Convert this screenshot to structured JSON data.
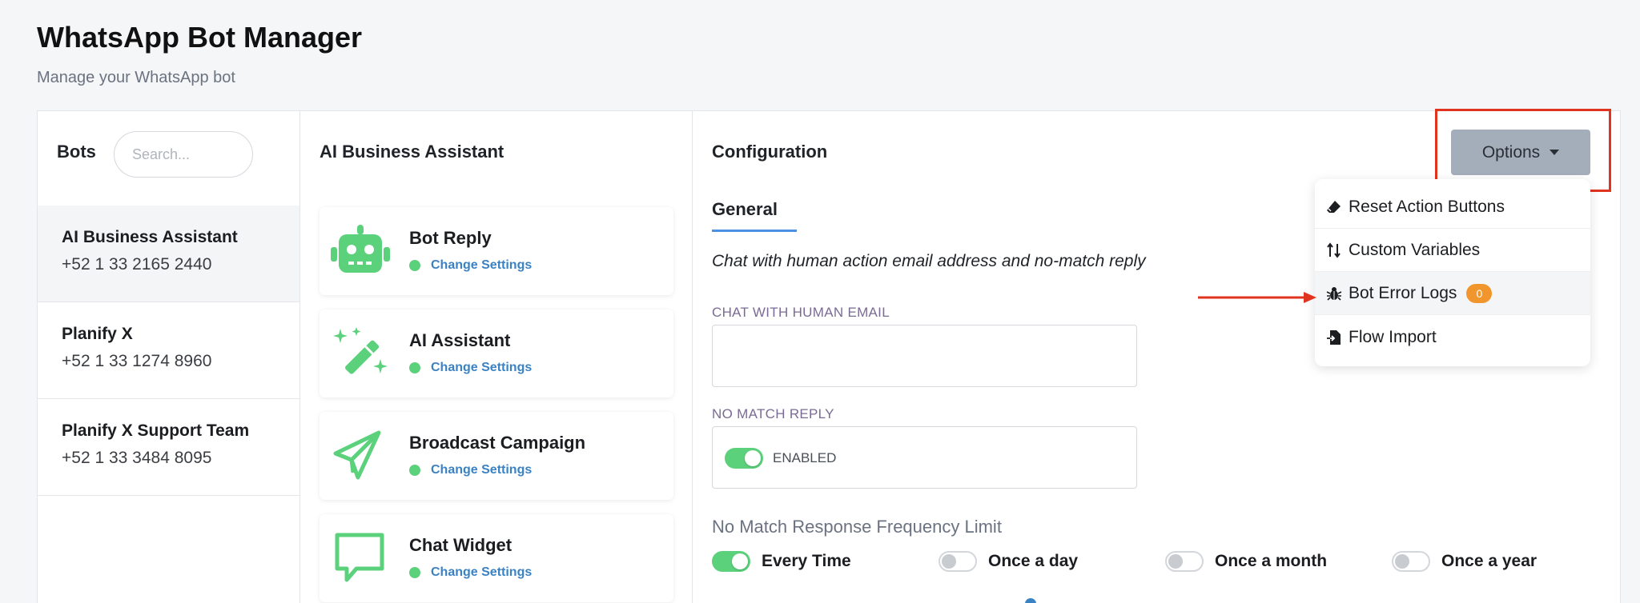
{
  "header": {
    "title": "WhatsApp Bot Manager",
    "subtitle": "Manage your WhatsApp bot"
  },
  "bots": {
    "title": "Bots",
    "search_placeholder": "Search...",
    "items": [
      {
        "name": "AI Business Assistant",
        "phone": "+52 1 33 2165 2440",
        "active": true
      },
      {
        "name": "Planify X",
        "phone": "+52 1 33 1274 8960",
        "active": false
      },
      {
        "name": "Planify X Support Team",
        "phone": "+52 1 33 3484 8095",
        "active": false
      }
    ]
  },
  "menu": {
    "title": "AI Business Assistant",
    "cards": [
      {
        "title": "Bot Reply",
        "link": "Change Settings",
        "icon": "robot-icon"
      },
      {
        "title": "AI Assistant",
        "link": "Change Settings",
        "icon": "magic-wand-icon"
      },
      {
        "title": "Broadcast Campaign",
        "link": "Change Settings",
        "icon": "paper-plane-icon"
      },
      {
        "title": "Chat Widget",
        "link": "Change Settings",
        "icon": "chat-bubble-icon"
      }
    ],
    "accent_color": "#5cd17c",
    "link_color": "#3b82c4"
  },
  "config": {
    "title": "Configuration",
    "tab": "General",
    "description": "Chat with human action email address and no-match reply",
    "email_label": "CHAT WITH HUMAN EMAIL",
    "email_value": "",
    "nomatch_label": "NO MATCH REPLY",
    "nomatch_state": "ENABLED",
    "frequency_title": "No Match Response Frequency Limit",
    "frequency_options": [
      {
        "label": "Every Time",
        "on": true
      },
      {
        "label": "Once a day",
        "on": false
      },
      {
        "label": "Once a month",
        "on": false
      },
      {
        "label": "Once a year",
        "on": false
      }
    ]
  },
  "options": {
    "button_label": "Options",
    "items": [
      {
        "label": "Reset Action Buttons",
        "icon": "eraser-icon"
      },
      {
        "label": "Custom Variables",
        "icon": "sort-arrows-icon"
      },
      {
        "label": "Bot Error Logs",
        "icon": "bug-icon",
        "badge": "0"
      },
      {
        "label": "Flow Import",
        "icon": "file-import-icon"
      }
    ],
    "badge_color": "#f0962c",
    "highlight_color": "#e0341f"
  }
}
